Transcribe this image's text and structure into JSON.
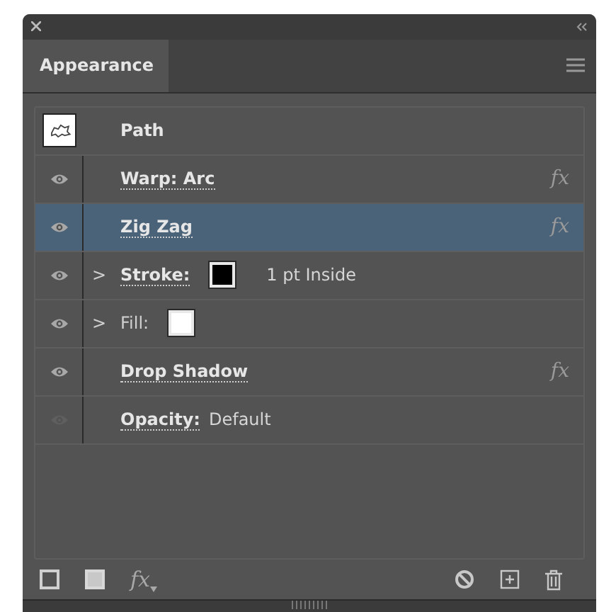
{
  "panel": {
    "tab": "Appearance",
    "selected": true
  },
  "rows": [
    {
      "kind": "object",
      "label": "Path",
      "selected": false
    },
    {
      "kind": "effect",
      "label": "Warp: Arc",
      "visible": true,
      "selected": false,
      "linked": true,
      "fx": "fx"
    },
    {
      "kind": "effect",
      "label": "Zig Zag",
      "visible": true,
      "selected": true,
      "linked": true,
      "fx": "fx"
    },
    {
      "kind": "attribute",
      "label": "Stroke:",
      "visible": true,
      "selected": false,
      "linked": true,
      "expanded": false,
      "chevron": ">",
      "color": "#000000",
      "value": "1 pt  Inside"
    },
    {
      "kind": "attribute",
      "label": "Fill:",
      "visible": true,
      "selected": false,
      "linked": false,
      "expanded": false,
      "chevron": ">",
      "color": "#ffffff"
    },
    {
      "kind": "effect",
      "label": "Drop Shadow",
      "visible": true,
      "selected": false,
      "linked": true,
      "fx": "fx"
    },
    {
      "kind": "effect",
      "label": "Opacity:",
      "visible": false,
      "selected": false,
      "linked": true,
      "value": "Default"
    }
  ],
  "toolbar": {
    "fx": "fx"
  }
}
